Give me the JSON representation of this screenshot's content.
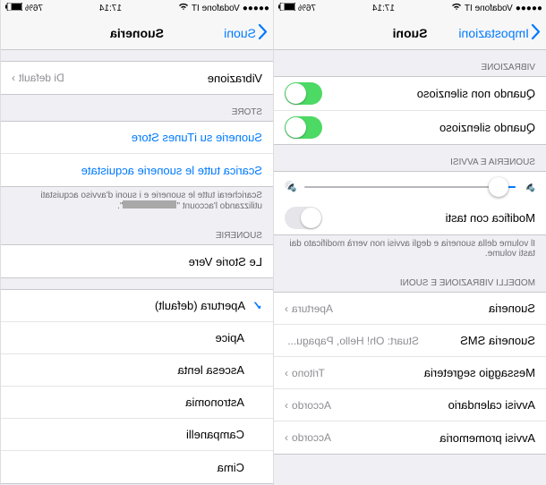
{
  "status": {
    "carrier": "Vodafone IT",
    "wifi": "wifi",
    "time": "17:14",
    "battery_pct": "76%"
  },
  "left": {
    "back": "Impostazioni",
    "title": "Suoni",
    "sections": {
      "vibrazione": {
        "header": "VIBRAZIONE",
        "rows": [
          {
            "label": "Quando non silenzioso",
            "on": true
          },
          {
            "label": "Quando silenzioso",
            "on": true
          }
        ]
      },
      "suoneria_avvisi": {
        "header": "SUONERIA E AVVISI",
        "modifica": {
          "label": "Modifica con tasti",
          "on": false
        },
        "footer": "Il volume della suoneria e degli avvisi non verrà modificato dai tasti volume."
      },
      "modelli": {
        "header": "MODELLI VIBRAZIONE E SUONI",
        "rows": [
          {
            "label": "Suoneria",
            "value": "Apertura"
          },
          {
            "label": "Suoneria SMS",
            "value": "Stuart: Oh! Hello, Papagu..."
          },
          {
            "label": "Messaggio segreteria",
            "value": "Tritono"
          },
          {
            "label": "Avvisi calendario",
            "value": "Accordo"
          },
          {
            "label": "Avvisi promemoria",
            "value": "Accordo"
          }
        ]
      }
    }
  },
  "right": {
    "back": "Suoni",
    "title": "Suoneria",
    "vibrazione": {
      "label": "Vibrazione",
      "value": "Di default"
    },
    "store": {
      "header": "STORE",
      "link1": "Suonerie su iTunes Store",
      "link2": "Scarica tutte le suonerie acquistate",
      "footer_pre": "Scaricherai tutte le suonerie e i suoni d'avviso acquistati utilizzando l'account \"",
      "footer_post": "\"."
    },
    "suonerie": {
      "header": "SUONERIE",
      "custom": "Le Storie Vere",
      "list": [
        {
          "label": "Apertura (default)",
          "checked": true
        },
        {
          "label": "Apice",
          "checked": false
        },
        {
          "label": "Ascesa lenta",
          "checked": false
        },
        {
          "label": "Astronomia",
          "checked": false
        },
        {
          "label": "Campanelli",
          "checked": false
        },
        {
          "label": "Cima",
          "checked": false
        }
      ]
    }
  }
}
